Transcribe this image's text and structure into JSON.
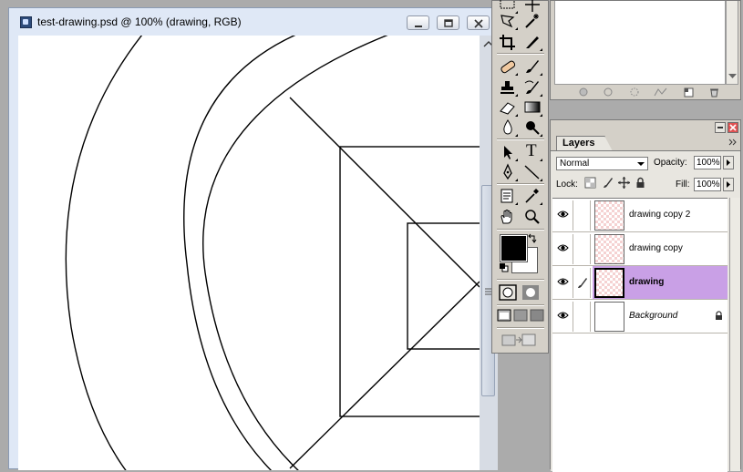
{
  "document_window": {
    "title": "test-drawing.psd @ 100% (drawing, RGB)",
    "buttons": [
      "minimize",
      "restore",
      "close"
    ],
    "background": "#dfe8f6"
  },
  "toolbox": {
    "tools": [
      "marquee-tool",
      "move-tool",
      "lasso-tool",
      "magic-wand-tool",
      "crop-tool",
      "slice-tool",
      "healing-brush-tool",
      "brush-tool",
      "clone-stamp-tool",
      "history-brush-tool",
      "eraser-tool",
      "gradient-tool",
      "blur-tool",
      "dodge-tool",
      "path-selection-tool",
      "type-tool",
      "pen-tool",
      "line-tool",
      "notes-tool",
      "eyedropper-tool",
      "hand-tool",
      "zoom-tool"
    ],
    "type_glyph": "T",
    "foreground_color": "#000000",
    "background_color": "#ffffff"
  },
  "layers_panel": {
    "tab_label": "Layers",
    "blend_mode": "Normal",
    "opacity_label": "Opacity:",
    "opacity_value": "100%",
    "lock_label": "Lock:",
    "fill_label": "Fill:",
    "fill_value": "100%",
    "selected_color": "#c9a0e6",
    "layers": [
      {
        "name": "drawing copy 2",
        "visible": true,
        "selected": false
      },
      {
        "name": "drawing copy",
        "visible": true,
        "selected": false
      },
      {
        "name": "drawing",
        "visible": true,
        "selected": true
      },
      {
        "name": "Background",
        "visible": true,
        "selected": false,
        "locked": true
      }
    ]
  }
}
